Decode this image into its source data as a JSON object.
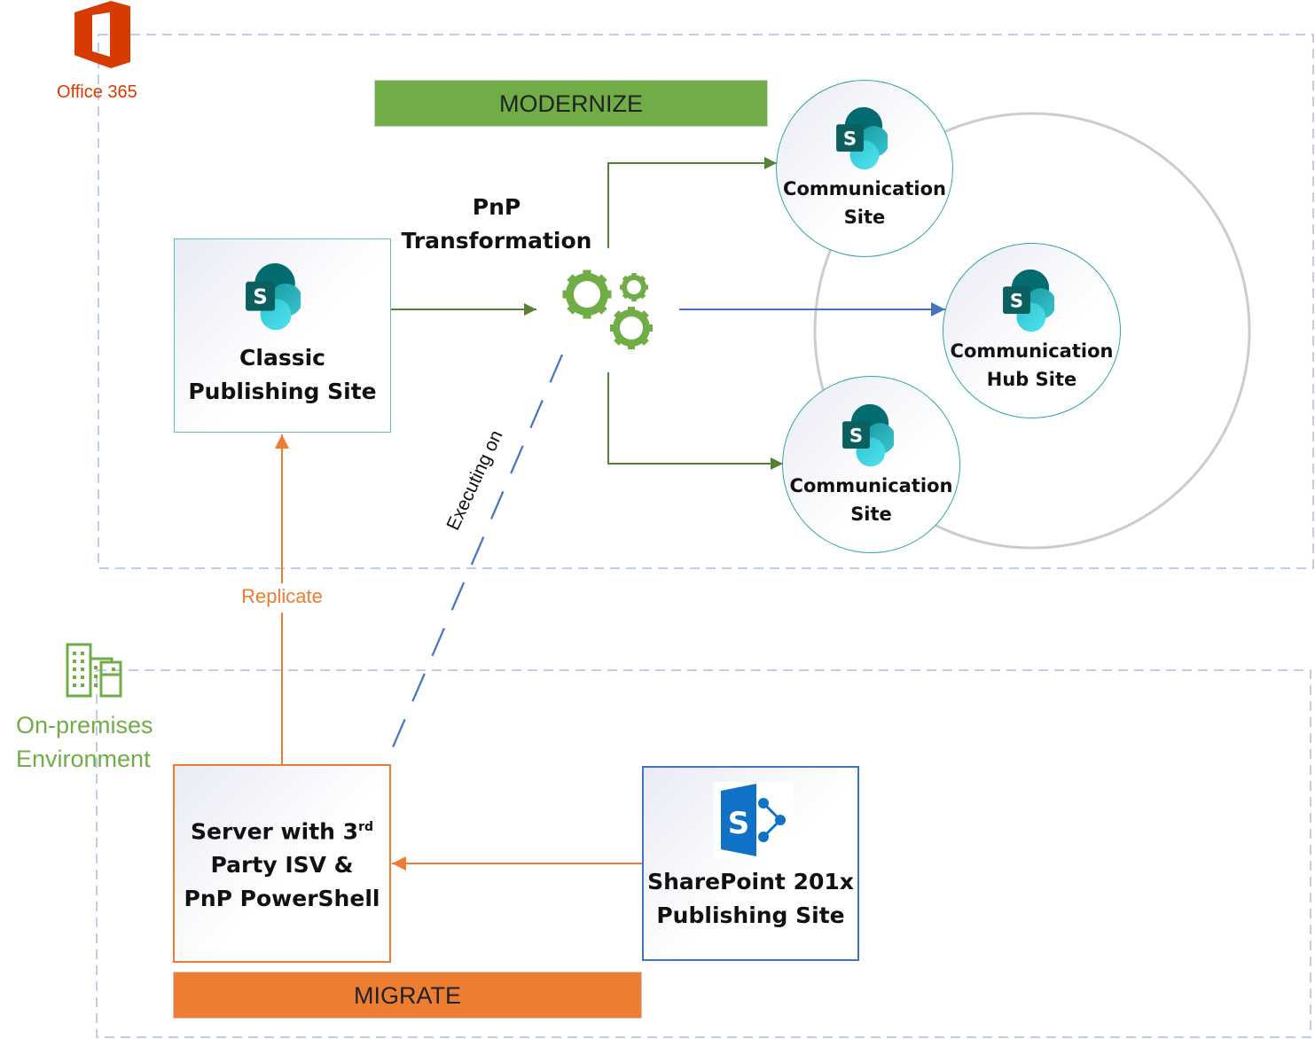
{
  "office365": {
    "label": "Office 365",
    "icon": "office365-logo-icon",
    "color": "#d83b01"
  },
  "onprem": {
    "label_line1": "On-premises",
    "label_line2": "Environment",
    "icon": "office-building-icon",
    "color": "#70ad47"
  },
  "modernize": {
    "label": "MODERNIZE",
    "color": "#70ad47"
  },
  "migrate": {
    "label": "MIGRATE",
    "color": "#ed7d31"
  },
  "classic_site": {
    "line1": "Classic",
    "line2": "Publishing Site",
    "icon": "sharepoint-online-icon"
  },
  "pnp": {
    "line1": "PnP",
    "line2": "Transformation",
    "icon": "gears-icon"
  },
  "comm_site_top": {
    "line1": "Communication",
    "line2": "Site"
  },
  "comm_hub": {
    "line1": "Communication",
    "line2": "Hub Site"
  },
  "comm_site_bottom": {
    "line1": "Communication",
    "line2": "Site"
  },
  "server": {
    "line1_main": "Server with 3",
    "line1_sup": "rd",
    "line2": "Party ISV &",
    "line3": "PnP PowerShell"
  },
  "sp201x": {
    "line1": "SharePoint 201x",
    "line2": "Publishing Site",
    "icon": "sharepoint-2013-icon"
  },
  "edges": {
    "replicate": "Replicate",
    "executing_on": "Executing on"
  },
  "colors": {
    "green_arrow": "#548235",
    "blue_arrow": "#4472c4",
    "orange_arrow": "#ed7d31",
    "teal_border": "#2ea6a6",
    "dashed_border": "#a9bde0",
    "hub_ring": "#cccccc"
  }
}
